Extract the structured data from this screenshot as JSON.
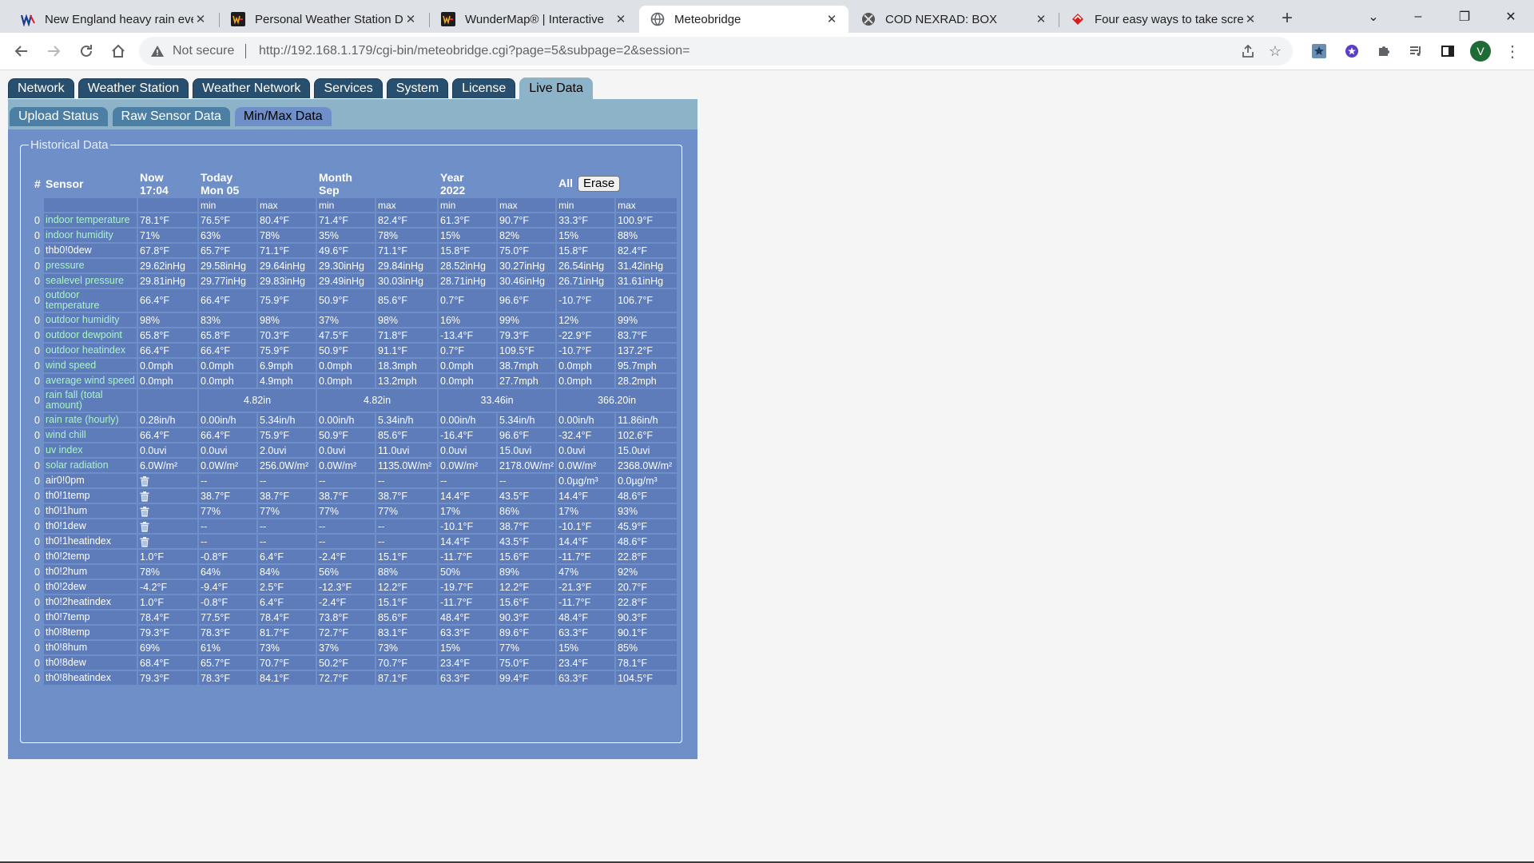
{
  "browser": {
    "tabs": [
      {
        "title": "New England heavy rain eve",
        "icon": "weathernerds-icon",
        "active": false
      },
      {
        "title": "Personal Weather Station D",
        "icon": "wunderground-icon",
        "active": false
      },
      {
        "title": "WunderMap® | Interactive",
        "icon": "wunderground-icon",
        "active": false
      },
      {
        "title": "Meteobridge",
        "icon": "globe-icon",
        "active": true
      },
      {
        "title": "COD NEXRAD: BOX",
        "icon": "cod-icon",
        "active": false
      },
      {
        "title": "Four easy ways to take scre",
        "icon": "red-logo-icon",
        "active": false
      }
    ],
    "not_secure_label": "Not secure",
    "url": "http://192.168.1.179/cgi-bin/meteobridge.cgi?page=5&subpage=2&session=",
    "profile_initial": "V"
  },
  "nav": {
    "main_tabs": [
      "Network",
      "Weather Station",
      "Weather Network",
      "Services",
      "System",
      "License",
      "Live Data"
    ],
    "active_main": "Live Data",
    "sub_tabs": [
      "Upload Status",
      "Raw Sensor Data",
      "Min/Max Data"
    ],
    "active_sub": "Min/Max Data"
  },
  "section_title": "Historical Data",
  "table": {
    "headers": {
      "num": "#",
      "sensor": "Sensor",
      "now": "Now",
      "now_sub": "17:04",
      "today": "Today",
      "today_sub": "Mon 05",
      "month": "Month",
      "month_sub": "Sep",
      "year": "Year",
      "year_sub": "2022",
      "all": "All",
      "erase": "Erase",
      "min": "min",
      "max": "max"
    },
    "rows": [
      {
        "n": "0",
        "name": "indoor temperature",
        "link": true,
        "now": "78.1°F",
        "v": [
          "76.5°F",
          "80.4°F",
          "71.4°F",
          "82.4°F",
          "61.3°F",
          "90.7°F",
          "33.3°F",
          "100.9°F"
        ]
      },
      {
        "n": "0",
        "name": "indoor humidity",
        "link": true,
        "now": "71%",
        "v": [
          "63%",
          "78%",
          "35%",
          "78%",
          "15%",
          "82%",
          "15%",
          "88%"
        ]
      },
      {
        "n": "0",
        "name": "thb0!0dew",
        "link": false,
        "now": "67.8°F",
        "v": [
          "65.7°F",
          "71.1°F",
          "49.6°F",
          "71.1°F",
          "15.8°F",
          "75.0°F",
          "15.8°F",
          "82.4°F"
        ]
      },
      {
        "n": "0",
        "name": "pressure",
        "link": true,
        "now": "29.62inHg",
        "v": [
          "29.58inHg",
          "29.64inHg",
          "29.30inHg",
          "29.84inHg",
          "28.52inHg",
          "30.27inHg",
          "26.54inHg",
          "31.42inHg"
        ]
      },
      {
        "n": "0",
        "name": "sealevel pressure",
        "link": true,
        "now": "29.81inHg",
        "v": [
          "29.77inHg",
          "29.83inHg",
          "29.49inHg",
          "30.03inHg",
          "28.71inHg",
          "30.46inHg",
          "26.71inHg",
          "31.61inHg"
        ]
      },
      {
        "n": "0",
        "name": "outdoor temperature",
        "link": true,
        "now": "66.4°F",
        "v": [
          "66.4°F",
          "75.9°F",
          "50.9°F",
          "85.6°F",
          "0.7°F",
          "96.6°F",
          "-10.7°F",
          "106.7°F"
        ]
      },
      {
        "n": "0",
        "name": "outdoor humidity",
        "link": true,
        "now": "98%",
        "v": [
          "83%",
          "98%",
          "37%",
          "98%",
          "16%",
          "99%",
          "12%",
          "99%"
        ]
      },
      {
        "n": "0",
        "name": "outdoor dewpoint",
        "link": true,
        "now": "65.8°F",
        "v": [
          "65.8°F",
          "70.3°F",
          "47.5°F",
          "71.8°F",
          "-13.4°F",
          "79.3°F",
          "-22.9°F",
          "83.7°F"
        ]
      },
      {
        "n": "0",
        "name": "outdoor heatindex",
        "link": true,
        "now": "66.4°F",
        "v": [
          "66.4°F",
          "75.9°F",
          "50.9°F",
          "91.1°F",
          "0.7°F",
          "109.5°F",
          "-10.7°F",
          "137.2°F"
        ]
      },
      {
        "n": "0",
        "name": "wind speed",
        "link": true,
        "now": "0.0mph",
        "v": [
          "0.0mph",
          "6.9mph",
          "0.0mph",
          "18.3mph",
          "0.0mph",
          "38.7mph",
          "0.0mph",
          "95.7mph"
        ]
      },
      {
        "n": "0",
        "name": "average wind speed",
        "link": true,
        "now": "0.0mph",
        "v": [
          "0.0mph",
          "4.9mph",
          "0.0mph",
          "13.2mph",
          "0.0mph",
          "27.7mph",
          "0.0mph",
          "28.2mph"
        ]
      },
      {
        "n": "0",
        "name": "rain fall (total amount)",
        "link": true,
        "now": "",
        "span": [
          "4.82in",
          "4.82in",
          "33.46in",
          "366.20in"
        ]
      },
      {
        "n": "0",
        "name": "rain rate (hourly)",
        "link": true,
        "now": "0.28in/h",
        "v": [
          "0.00in/h",
          "5.34in/h",
          "0.00in/h",
          "5.34in/h",
          "0.00in/h",
          "5.34in/h",
          "0.00in/h",
          "11.86in/h"
        ]
      },
      {
        "n": "0",
        "name": "wind chill",
        "link": true,
        "now": "66.4°F",
        "v": [
          "66.4°F",
          "75.9°F",
          "50.9°F",
          "85.6°F",
          "-16.4°F",
          "96.6°F",
          "-32.4°F",
          "102.6°F"
        ]
      },
      {
        "n": "0",
        "name": "uv index",
        "link": true,
        "now": "0.0uvi",
        "v": [
          "0.0uvi",
          "2.0uvi",
          "0.0uvi",
          "11.0uvi",
          "0.0uvi",
          "15.0uvi",
          "0.0uvi",
          "15.0uvi"
        ]
      },
      {
        "n": "0",
        "name": "solar radiation",
        "link": true,
        "now": "6.0W/m²",
        "v": [
          "0.0W/m²",
          "256.0W/m²",
          "0.0W/m²",
          "1135.0W/m²",
          "0.0W/m²",
          "2178.0W/m²",
          "0.0W/m²",
          "2368.0W/m²"
        ]
      },
      {
        "n": "0",
        "name": "air0!0pm",
        "link": false,
        "trash": true,
        "now": "",
        "v": [
          "--",
          "--",
          "--",
          "--",
          "--",
          "--",
          "0.0µg/m³",
          "0.0µg/m³"
        ]
      },
      {
        "n": "0",
        "name": "th0!1temp",
        "link": false,
        "trash": true,
        "now": "",
        "v": [
          "38.7°F",
          "38.7°F",
          "38.7°F",
          "38.7°F",
          "14.4°F",
          "43.5°F",
          "14.4°F",
          "48.6°F"
        ]
      },
      {
        "n": "0",
        "name": "th0!1hum",
        "link": false,
        "trash": true,
        "now": "",
        "v": [
          "77%",
          "77%",
          "77%",
          "77%",
          "17%",
          "86%",
          "17%",
          "93%"
        ]
      },
      {
        "n": "0",
        "name": "th0!1dew",
        "link": false,
        "trash": true,
        "now": "",
        "v": [
          "--",
          "--",
          "--",
          "--",
          "-10.1°F",
          "38.7°F",
          "-10.1°F",
          "45.9°F"
        ]
      },
      {
        "n": "0",
        "name": "th0!1heatindex",
        "link": false,
        "trash": true,
        "now": "",
        "v": [
          "--",
          "--",
          "--",
          "--",
          "14.4°F",
          "43.5°F",
          "14.4°F",
          "48.6°F"
        ]
      },
      {
        "n": "0",
        "name": "th0!2temp",
        "link": false,
        "now": "1.0°F",
        "v": [
          "-0.8°F",
          "6.4°F",
          "-2.4°F",
          "15.1°F",
          "-11.7°F",
          "15.6°F",
          "-11.7°F",
          "22.8°F"
        ]
      },
      {
        "n": "0",
        "name": "th0!2hum",
        "link": false,
        "now": "78%",
        "v": [
          "64%",
          "84%",
          "56%",
          "88%",
          "50%",
          "89%",
          "47%",
          "92%"
        ]
      },
      {
        "n": "0",
        "name": "th0!2dew",
        "link": false,
        "now": "-4.2°F",
        "v": [
          "-9.4°F",
          "2.5°F",
          "-12.3°F",
          "12.2°F",
          "-19.7°F",
          "12.2°F",
          "-21.3°F",
          "20.7°F"
        ]
      },
      {
        "n": "0",
        "name": "th0!2heatindex",
        "link": false,
        "now": "1.0°F",
        "v": [
          "-0.8°F",
          "6.4°F",
          "-2.4°F",
          "15.1°F",
          "-11.7°F",
          "15.6°F",
          "-11.7°F",
          "22.8°F"
        ]
      },
      {
        "n": "0",
        "name": "th0!7temp",
        "link": false,
        "now": "78.4°F",
        "v": [
          "77.5°F",
          "78.4°F",
          "73.8°F",
          "85.6°F",
          "48.4°F",
          "90.3°F",
          "48.4°F",
          "90.3°F"
        ]
      },
      {
        "n": "0",
        "name": "th0!8temp",
        "link": false,
        "now": "79.3°F",
        "v": [
          "78.3°F",
          "81.7°F",
          "72.7°F",
          "83.1°F",
          "63.3°F",
          "89.6°F",
          "63.3°F",
          "90.1°F"
        ]
      },
      {
        "n": "0",
        "name": "th0!8hum",
        "link": false,
        "now": "69%",
        "v": [
          "61%",
          "73%",
          "37%",
          "73%",
          "15%",
          "77%",
          "15%",
          "85%"
        ]
      },
      {
        "n": "0",
        "name": "th0!8dew",
        "link": false,
        "now": "68.4°F",
        "v": [
          "65.7°F",
          "70.7°F",
          "50.2°F",
          "70.7°F",
          "23.4°F",
          "75.0°F",
          "23.4°F",
          "78.1°F"
        ]
      },
      {
        "n": "0",
        "name": "th0!8heatindex",
        "link": false,
        "now": "79.3°F",
        "v": [
          "78.3°F",
          "84.1°F",
          "72.7°F",
          "87.1°F",
          "63.3°F",
          "99.4°F",
          "63.3°F",
          "104.5°F"
        ]
      }
    ]
  }
}
